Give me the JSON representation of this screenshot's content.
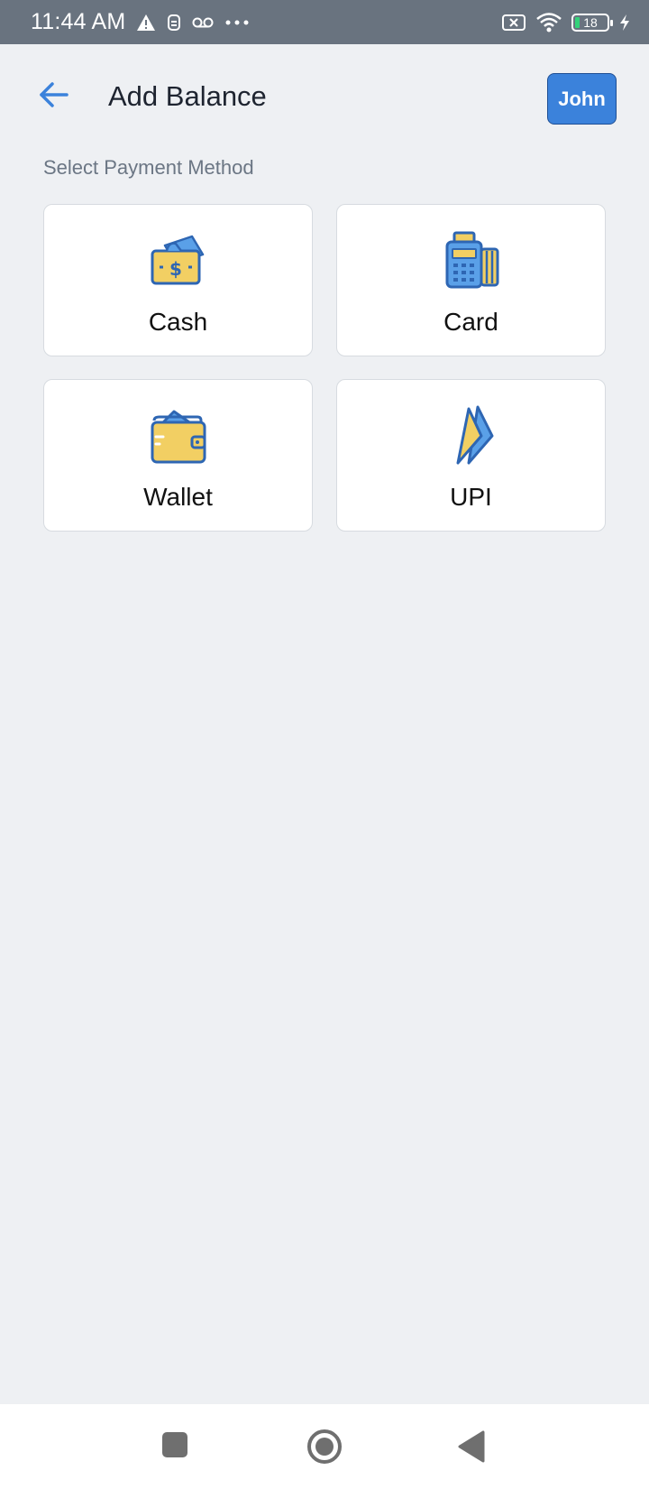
{
  "status_bar": {
    "time": "11:44 AM",
    "battery_level": "18",
    "icons": [
      "warning-icon",
      "sim-icon",
      "voicemail-icon",
      "more-dots-icon",
      "no-sim-icon",
      "wifi-icon",
      "battery-icon",
      "charging-icon"
    ]
  },
  "header": {
    "title": "Add Balance",
    "user_label": "John"
  },
  "section": {
    "label": "Select Payment Method"
  },
  "methods": [
    {
      "label": "Cash",
      "icon": "cash-icon"
    },
    {
      "label": "Card",
      "icon": "card-terminal-icon"
    },
    {
      "label": "Wallet",
      "icon": "wallet-icon"
    },
    {
      "label": "UPI",
      "icon": "upi-icon"
    }
  ],
  "colors": {
    "accent": "#3b82db",
    "icon_blue": "#3f7fd0",
    "icon_yellow": "#f2cf63",
    "background": "#eef0f3",
    "status_bar": "#69737f"
  }
}
